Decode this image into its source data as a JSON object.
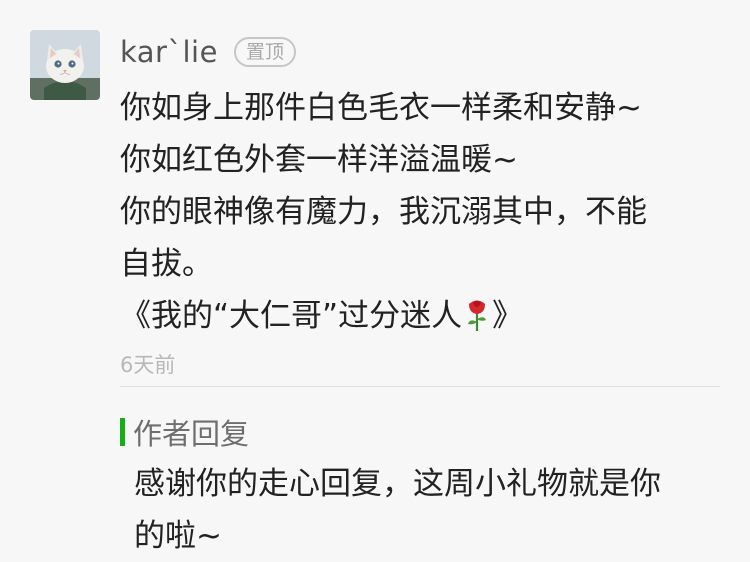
{
  "comment": {
    "username": "kar`lie",
    "pin_badge": "置顶",
    "lines": [
      "你如身上那件白色毛衣一样柔和安静~",
      "你如红色外套一样洋溢温暖~",
      "你的眼神像有魔力，我沉溺其中，不能",
      "自拔。"
    ],
    "last_line_before_icon": "《我的“大仁哥”过分迷人",
    "last_line_after_icon": "》",
    "timestamp": "6天前"
  },
  "reply": {
    "title": "作者回复",
    "lines": [
      "感谢你的走心回复，这周小礼物就是你",
      "的啦~"
    ]
  },
  "colors": {
    "background": "#f7f7f7",
    "text": "#222222",
    "username": "#555555",
    "reply_accent": "#1aad19"
  },
  "icons": [
    "rose-icon"
  ]
}
